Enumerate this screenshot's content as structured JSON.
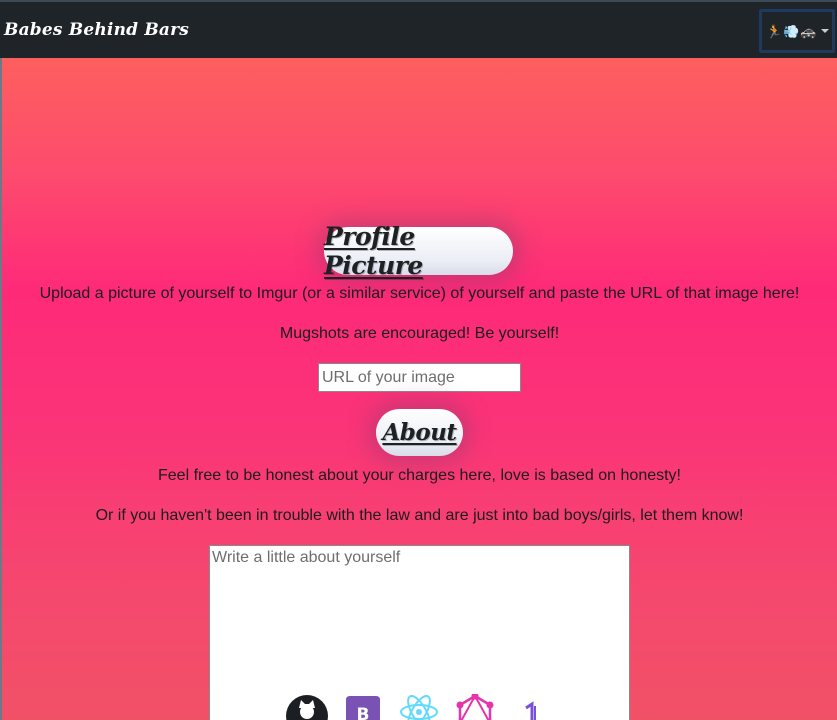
{
  "navbar": {
    "brand": "Babes Behind Bars",
    "toggle_emojis": [
      "🏃",
      "💨",
      "🚓"
    ]
  },
  "profile_section": {
    "heading": "Profile Picture",
    "paragraph_1": "Upload a picture of yourself to Imgur (or a similar service) of yourself and paste the URL of that image here!",
    "paragraph_2": "Mugshots are encouraged! Be yourself!",
    "url_input": {
      "value": "",
      "placeholder": "URL of your image"
    }
  },
  "about_section": {
    "heading": "About",
    "paragraph_1": "Feel free to be honest about your charges here, love is based on honesty!",
    "paragraph_2": "Or if you haven't been in trouble with the law and are just into bad boys/girls, let them know!",
    "textarea": {
      "value": "",
      "placeholder": "Write a little about yourself"
    }
  },
  "tech_icons": [
    "github-icon",
    "bootstrap-icon",
    "react-icon",
    "graphql-icon",
    "number-one-icon"
  ],
  "colors": {
    "navbar_bg": "#1f2428",
    "gradient_top": "#fd5f5e",
    "gradient_mid": "#fe2a78",
    "gradient_bottom": "#f15167",
    "heading_text": "#1e2124",
    "body_text": "#1c1c1c"
  }
}
